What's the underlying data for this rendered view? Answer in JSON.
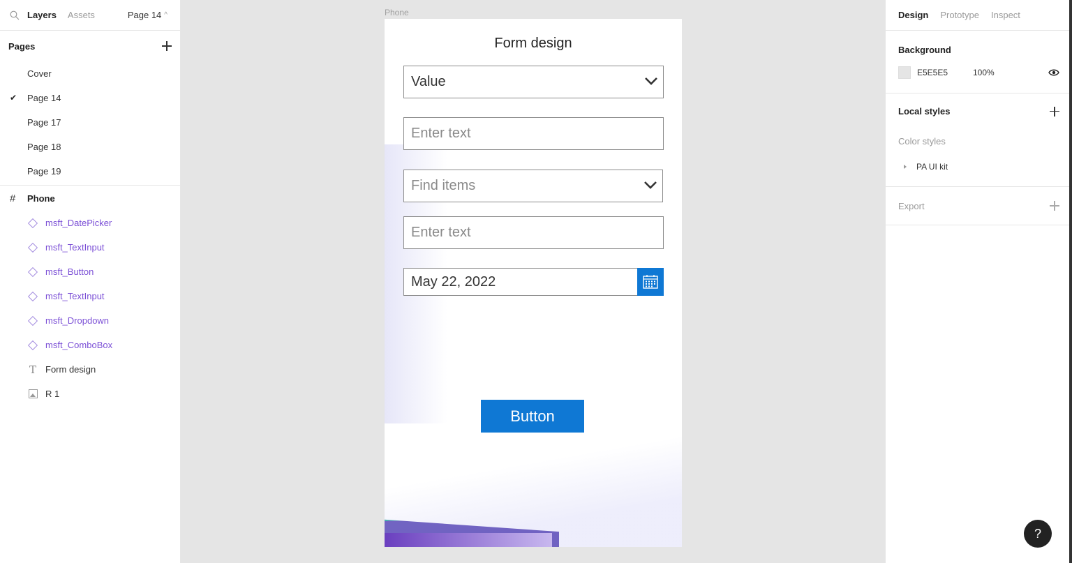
{
  "left_panel": {
    "tabs": [
      "Layers",
      "Assets"
    ],
    "current_page": "Page 14",
    "pages_header": "Pages",
    "pages": [
      {
        "label": "Cover",
        "selected": false
      },
      {
        "label": "Page 14",
        "selected": true
      },
      {
        "label": "Page 17",
        "selected": false
      },
      {
        "label": "Page 18",
        "selected": false
      },
      {
        "label": "Page 19",
        "selected": false
      }
    ],
    "frame_layer": "Phone",
    "layers": [
      {
        "label": "msft_DatePicker",
        "icon": "component-icon"
      },
      {
        "label": "msft_TextInput",
        "icon": "component-icon"
      },
      {
        "label": "msft_Button",
        "icon": "component-icon"
      },
      {
        "label": "msft_TextInput",
        "icon": "component-icon"
      },
      {
        "label": "msft_Dropdown",
        "icon": "component-icon"
      },
      {
        "label": "msft_ComboBox",
        "icon": "component-icon"
      },
      {
        "label": "Form design",
        "icon": "text-icon"
      },
      {
        "label": "R 1",
        "icon": "image-icon"
      }
    ]
  },
  "canvas": {
    "frame_label": "Phone",
    "form_title": "Form design",
    "dropdown_value": "Value",
    "text_input_1_placeholder": "Enter text",
    "combobox_placeholder": "Find items",
    "text_input_2_placeholder": "Enter text",
    "date_value": "May 22, 2022",
    "button_label": "Button"
  },
  "right_panel": {
    "tabs": [
      "Design",
      "Prototype",
      "Inspect"
    ],
    "background_title": "Background",
    "background_hex": "E5E5E5",
    "background_opacity": "100%",
    "local_styles_title": "Local styles",
    "color_styles_label": "Color styles",
    "color_style_group": "PA UI kit",
    "export_title": "Export"
  },
  "help_label": "?",
  "colors": {
    "accent": "#0F78D4",
    "canvas_bg": "#E5E5E5",
    "component": "#7B4FD6"
  }
}
